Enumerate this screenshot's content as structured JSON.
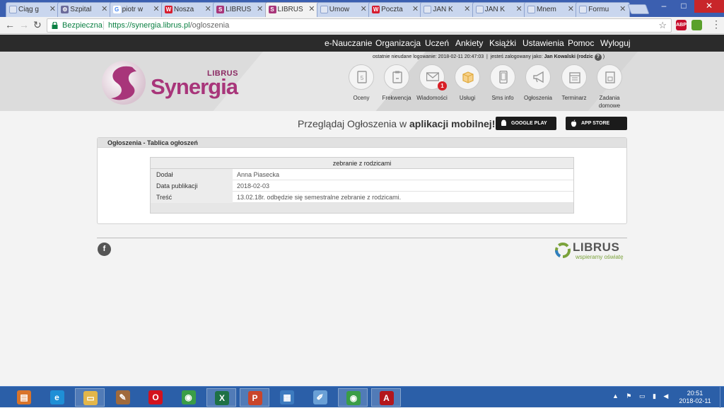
{
  "browser": {
    "tabs": [
      {
        "label": "Ciąg g",
        "icon": "document-icon",
        "color": "#e0e6f2",
        "glyph": ""
      },
      {
        "label": "Szpital",
        "icon": "gear-icon",
        "color": "#6b6b9a",
        "glyph": "⚙"
      },
      {
        "label": "piotr w",
        "icon": "google-icon",
        "color": "#ffffff",
        "glyph": "G"
      },
      {
        "label": "Nosza",
        "icon": "wp-icon",
        "color": "#d61d2f",
        "glyph": "W"
      },
      {
        "label": "LIBRUS",
        "icon": "librus-icon",
        "color": "#a8357a",
        "glyph": "S"
      },
      {
        "label": "LIBRUS",
        "icon": "librus-icon",
        "color": "#a8357a",
        "glyph": "S"
      },
      {
        "label": "Umow",
        "icon": "document-icon",
        "color": "#e0e6f2",
        "glyph": ""
      },
      {
        "label": "Poczta",
        "icon": "wp-icon",
        "color": "#d61d2f",
        "glyph": "W"
      },
      {
        "label": "JAN K",
        "icon": "document-icon",
        "color": "#e0e6f2",
        "glyph": ""
      },
      {
        "label": "JAN K",
        "icon": "document-icon",
        "color": "#e0e6f2",
        "glyph": ""
      },
      {
        "label": "Mnem",
        "icon": "document-icon",
        "color": "#e0e6f2",
        "glyph": ""
      },
      {
        "label": "Formu",
        "icon": "document-icon",
        "color": "#e0e6f2",
        "glyph": ""
      }
    ],
    "active_tab": 5,
    "close_glyph": "✕",
    "secure_label": "Bezpieczna",
    "url_host": "https://synergia.librus.pl",
    "url_path": "/ogloszenia",
    "extensions": [
      {
        "name": "adblock-icon",
        "text": "ABP",
        "color": "#c70d2c"
      },
      {
        "name": "extension-icon",
        "text": "",
        "color": "#5aa02c"
      }
    ]
  },
  "nav": {
    "items": [
      "e-Nauczanie",
      "Organizacja",
      "Uczeń",
      "Ankiety",
      "Książki",
      "Ustawienia",
      "Pomoc",
      "Wyloguj"
    ]
  },
  "header": {
    "last_login_label": "ostatnie nieudane logowanie: 2018-02-11 20:47:03",
    "separator": "|",
    "logged_in_label": "jesteś zalogowany jako:",
    "user": "Jan Kowalski (rodzic",
    "user_close": ")",
    "help_glyph": "?",
    "logo_brand": "LIBRUS",
    "logo_product": "Synergia",
    "modules": [
      {
        "label": "Oceny",
        "icon": "grades-icon"
      },
      {
        "label": "Frekwencja",
        "icon": "attendance-icon"
      },
      {
        "label": "Wiadomości",
        "icon": "envelope-icon",
        "badge": "1"
      },
      {
        "label": "Usługi",
        "icon": "box-icon"
      },
      {
        "label": "Sms info",
        "icon": "phone-icon"
      },
      {
        "label": "Ogłoszenia",
        "icon": "megaphone-icon"
      },
      {
        "label": "Terminarz",
        "icon": "calendar-icon"
      },
      {
        "label": "Zadania domowe",
        "icon": "homework-icon"
      }
    ]
  },
  "promo": {
    "text": "Przeglądaj Ogłoszenia w",
    "bold": "aplikacji mobilnej!",
    "google_play": "GOOGLE PLAY",
    "app_store": "APP STORE"
  },
  "panel": {
    "title": "Ogłoszenia - Tablica ogłoszeń",
    "notice": {
      "title": "zebranie z rodzicami",
      "rows": [
        {
          "label": "Dodał",
          "value": "Anna Piasecka"
        },
        {
          "label": "Data publikacji",
          "value": "2018-02-03"
        },
        {
          "label": "Treść",
          "value": "13.02.18r. odbędzie się semestralne zebranie z rodzicami."
        }
      ]
    }
  },
  "footer": {
    "brand": "LIBRUS",
    "slogan": "wspieramy oświatę",
    "fb_glyph": "f"
  },
  "taskbar": {
    "apps": [
      {
        "name": "taskbar-app-files",
        "icon": "files-icon",
        "color": "#d9742a",
        "glyph": "▤",
        "open": false
      },
      {
        "name": "taskbar-app-ie",
        "icon": "internet-explorer-icon",
        "color": "#1f8fd6",
        "glyph": "e",
        "open": false
      },
      {
        "name": "taskbar-app-explorer",
        "icon": "folder-icon",
        "color": "#e3b64a",
        "glyph": "▭",
        "open": true
      },
      {
        "name": "taskbar-app-editor",
        "icon": "editor-icon",
        "color": "#a06a3c",
        "glyph": "✎",
        "open": false
      },
      {
        "name": "taskbar-app-opera",
        "icon": "opera-icon",
        "color": "#d3121e",
        "glyph": "O",
        "open": false
      },
      {
        "name": "taskbar-app-chrome",
        "icon": "chrome-icon",
        "color": "#3a9d47",
        "glyph": "◉",
        "open": false
      },
      {
        "name": "taskbar-app-excel",
        "icon": "excel-icon",
        "color": "#1e7145",
        "glyph": "X",
        "open": true
      },
      {
        "name": "taskbar-app-powerpoint",
        "icon": "powerpoint-icon",
        "color": "#c9452b",
        "glyph": "P",
        "open": true
      },
      {
        "name": "taskbar-app-remote",
        "icon": "remote-desktop-icon",
        "color": "#3d7bbf",
        "glyph": "▦",
        "open": false
      },
      {
        "name": "taskbar-app-paint",
        "icon": "paint-icon",
        "color": "#6aa0d6",
        "glyph": "✐",
        "open": false
      },
      {
        "name": "taskbar-app-chrome-active",
        "icon": "chrome-icon",
        "color": "#3a9d47",
        "glyph": "◉",
        "open": true
      },
      {
        "name": "taskbar-app-acrobat",
        "icon": "acrobat-icon",
        "color": "#b3161c",
        "glyph": "A",
        "open": true
      }
    ],
    "tray": "▲ ⚑ ▭ ▮ ◀",
    "time": "20:51",
    "date": "2018-02-11"
  }
}
